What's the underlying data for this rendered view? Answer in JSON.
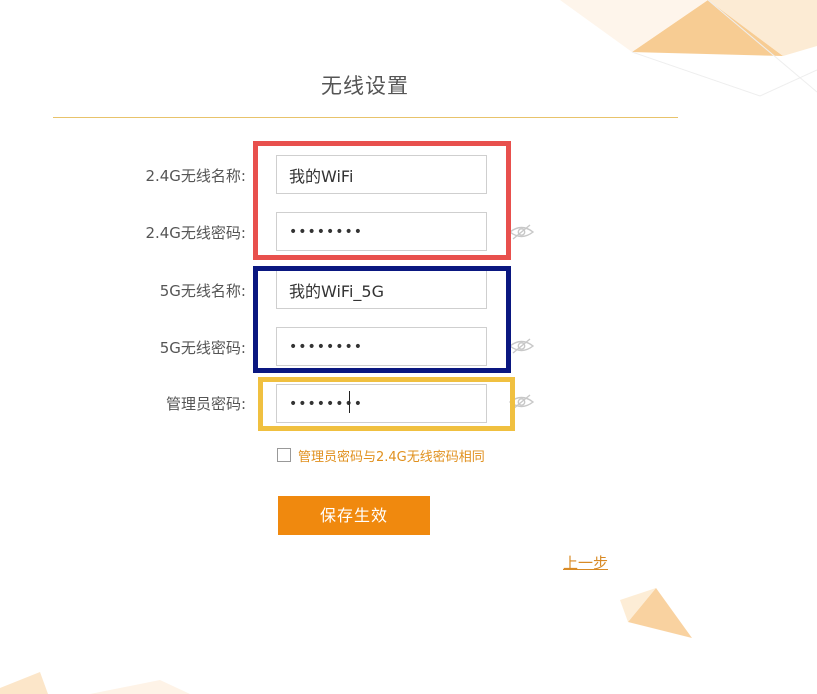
{
  "page": {
    "title": "无线设置"
  },
  "form": {
    "ssid_24": {
      "label": "2.4G无线名称:",
      "value": "我的WiFi"
    },
    "password_24": {
      "label": "2.4G无线密码:",
      "value": "••••••••"
    },
    "ssid_5": {
      "label": "5G无线名称:",
      "value": "我的WiFi_5G"
    },
    "password_5": {
      "label": "5G无线密码:",
      "value": "••••••••"
    },
    "admin_password": {
      "label": "管理员密码:",
      "value": "••••••••"
    },
    "same_password_checkbox": {
      "label": "管理员密码与2.4G无线密码相同",
      "checked": false
    },
    "save_label": "保存生效",
    "back_label": "上一步"
  },
  "icons": {
    "password_visibility": "eye-slash-icon",
    "checkbox": "checkbox-icon"
  },
  "colors": {
    "accent": "#f0890e",
    "link": "#d88a25",
    "title_rule": "#e8c36b",
    "highlight_24g": "#e8504d",
    "highlight_5g": "#0a1780",
    "highlight_admin": "#f0c040"
  }
}
